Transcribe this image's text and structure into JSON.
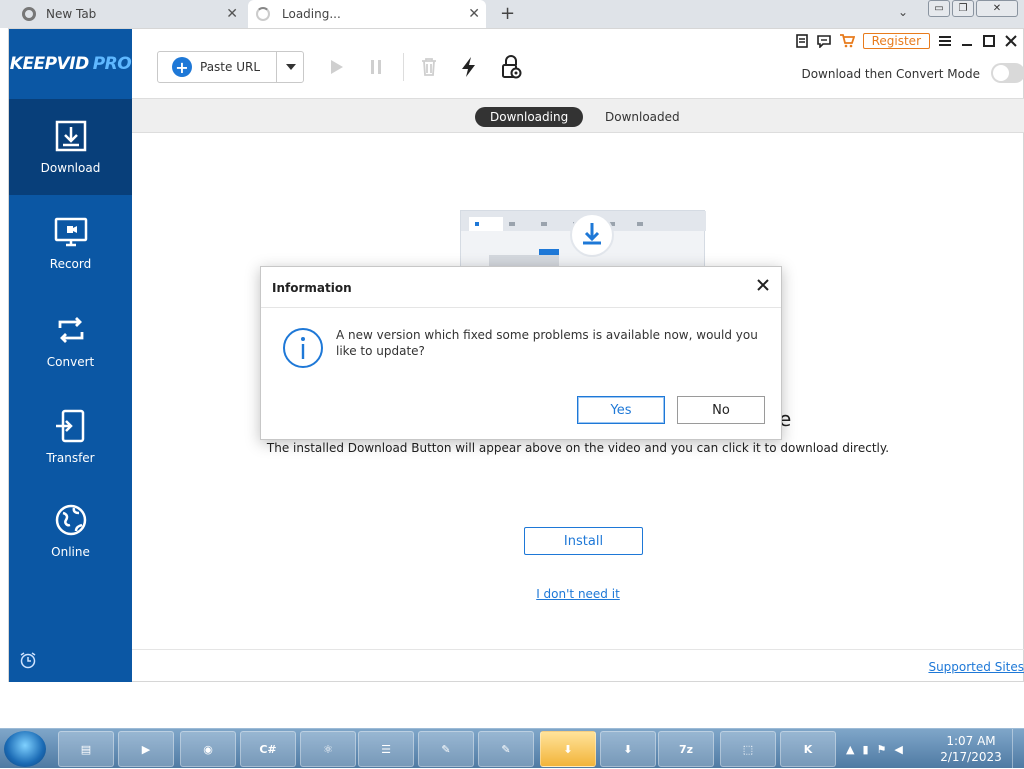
{
  "browser": {
    "tabs": [
      {
        "title": "New Tab"
      },
      {
        "title": "Loading..."
      }
    ],
    "new_tab": "+",
    "controls": {
      "minimize": "▭",
      "restore": "❐",
      "close": "✕"
    }
  },
  "app": {
    "logo": {
      "main": "KEEPVID",
      "accent": "PRO"
    },
    "sidebar": [
      {
        "label": "Download",
        "icon": "download-icon",
        "active": true
      },
      {
        "label": "Record",
        "icon": "monitor-record-icon",
        "active": false
      },
      {
        "label": "Convert",
        "icon": "convert-icon",
        "active": false
      },
      {
        "label": "Transfer",
        "icon": "transfer-icon",
        "active": false
      },
      {
        "label": "Online",
        "icon": "globe-icon",
        "active": false
      }
    ],
    "toolbar": {
      "paste_url": "Paste URL",
      "register": "Register",
      "mode_label": "Download then Convert Mode"
    },
    "tabs": {
      "active": "Downloading",
      "other": "Downloaded"
    },
    "content": {
      "clipped_heading": "e",
      "description": "The installed Download Button will appear above on the video and you can click it to download directly.",
      "install": "Install",
      "dont_need": "I don't need it",
      "supported_sites": "Supported Sites"
    },
    "dialog": {
      "title": "Information",
      "message": "A new version which fixed some problems is available now, would you like to update?",
      "yes": "Yes",
      "no": "No"
    }
  },
  "taskbar": {
    "items": [
      "explorer",
      "media player",
      "chrome",
      "csharp",
      "atom",
      "list",
      "notepad",
      "notepad2",
      "setup",
      "setup2",
      "7z",
      "network",
      "keepvid"
    ],
    "time": "1:07 AM",
    "date": "2/17/2023"
  },
  "colors": {
    "sidebar": "#0b57a4",
    "accent": "#1e78d7",
    "register": "#e87b1c"
  }
}
